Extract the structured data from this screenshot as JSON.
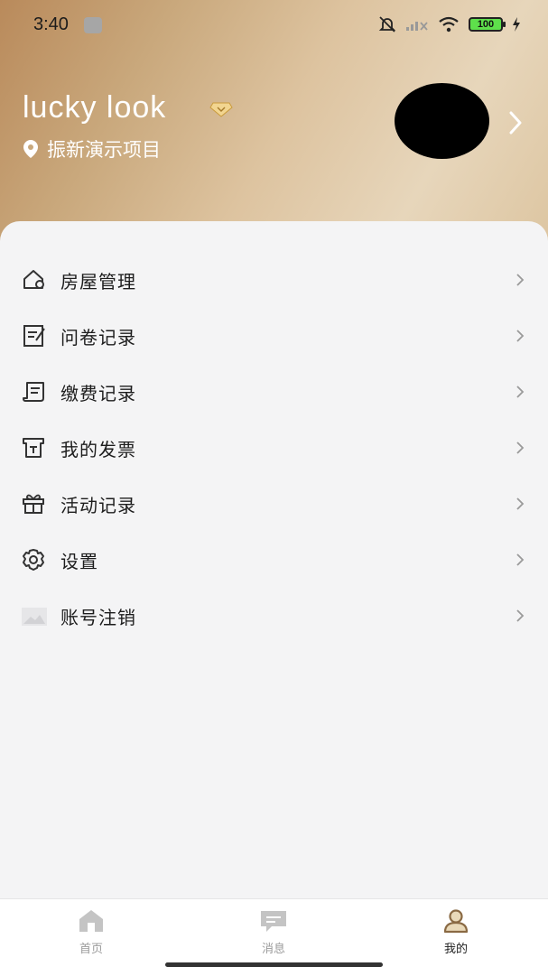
{
  "status": {
    "time": "3:40",
    "battery": "100"
  },
  "profile": {
    "username": "lucky look",
    "project": "振新演示项目"
  },
  "menu": {
    "items": [
      {
        "label": "房屋管理",
        "icon": "house-icon"
      },
      {
        "label": "问卷记录",
        "icon": "questionnaire-icon"
      },
      {
        "label": "缴费记录",
        "icon": "payment-record-icon"
      },
      {
        "label": "我的发票",
        "icon": "invoice-icon"
      },
      {
        "label": "活动记录",
        "icon": "gift-icon"
      },
      {
        "label": "设置",
        "icon": "settings-gear-icon"
      },
      {
        "label": "账号注销",
        "icon": "image-placeholder-icon"
      }
    ]
  },
  "tabbar": {
    "home": "首页",
    "messages": "消息",
    "mine": "我的"
  },
  "colors": {
    "header_gradient_start": "#b98a5b",
    "header_gradient_end": "#e7d6bb",
    "active_tab": "#8a6a44",
    "inactive_tab": "#b9b9b9"
  }
}
